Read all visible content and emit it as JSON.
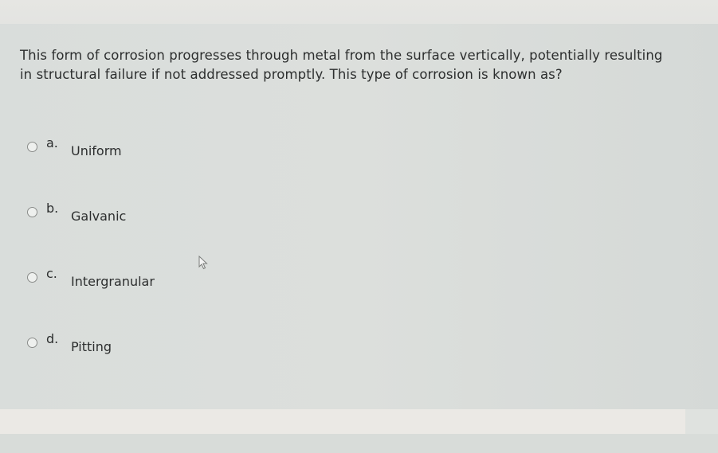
{
  "question": {
    "text": "This form of corrosion progresses through metal from the surface vertically, potentially resulting in structural failure if not addressed promptly. This type of corrosion is known as?"
  },
  "options": [
    {
      "letter": "a.",
      "label": "Uniform",
      "selected": false
    },
    {
      "letter": "b.",
      "label": "Galvanic",
      "selected": false
    },
    {
      "letter": "c.",
      "label": "Intergranular",
      "selected": false
    },
    {
      "letter": "d.",
      "label": "Pitting",
      "selected": false
    }
  ],
  "cursor": {
    "icon": "arrow-pointer-icon"
  }
}
